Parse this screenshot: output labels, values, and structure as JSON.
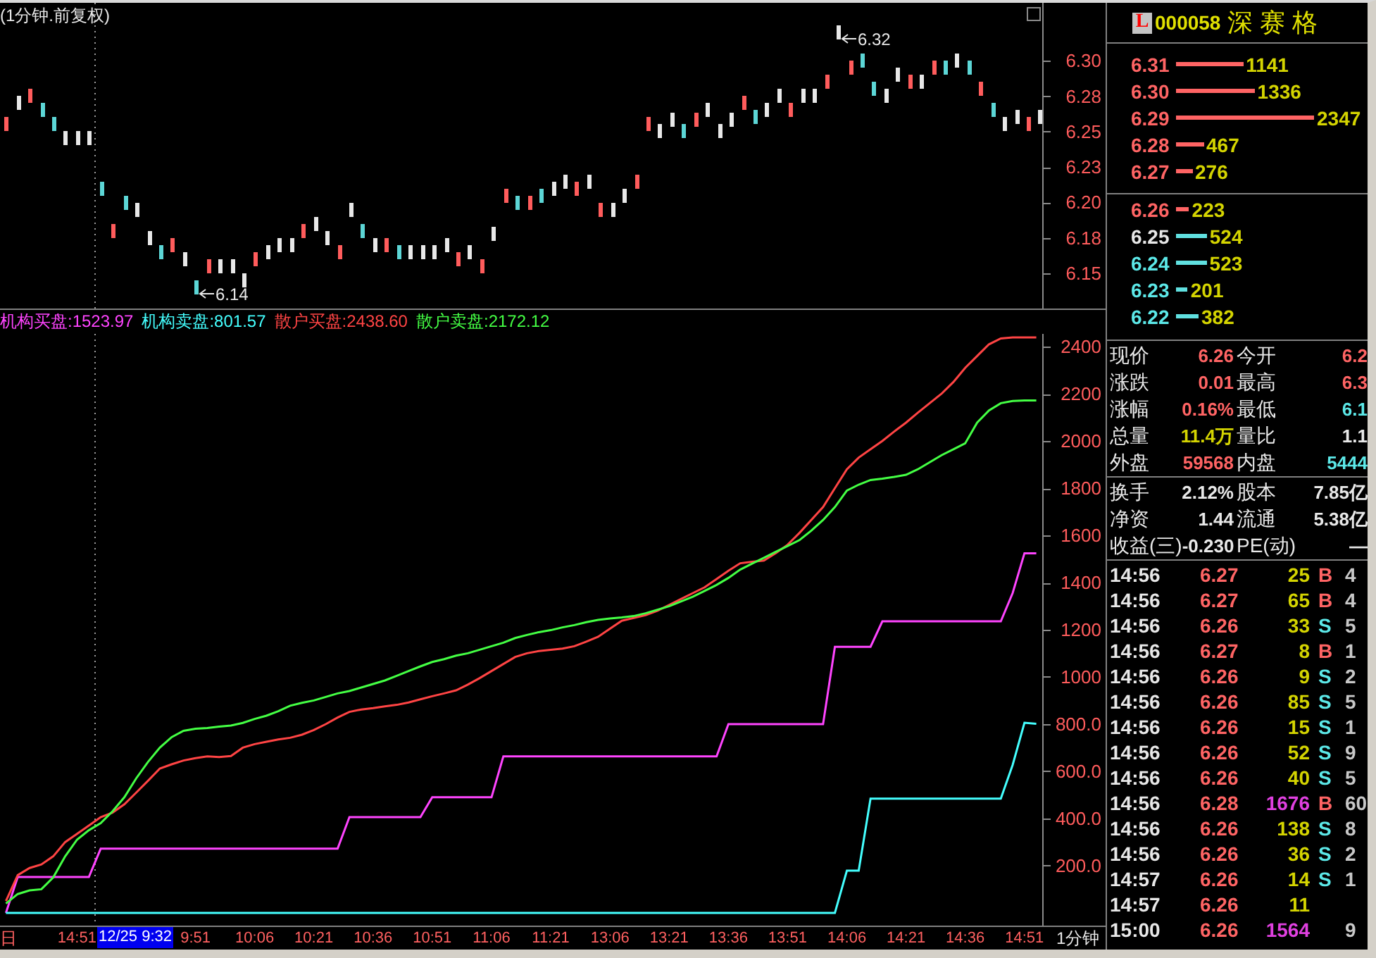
{
  "price_chart": {
    "chart_data": {
      "type": "scatter",
      "title": "(1分钟.前复权)",
      "categories": [
        null,
        null,
        null,
        null,
        null,
        null,
        null,
        null,
        null,
        null,
        null,
        null,
        null,
        null,
        null,
        null,
        null,
        null,
        null,
        null,
        null,
        null,
        null,
        null,
        null,
        null,
        null,
        null,
        null,
        null,
        null,
        null,
        null,
        null,
        null,
        null,
        null,
        null,
        null,
        null,
        null,
        null,
        null,
        null,
        null,
        null,
        null,
        null,
        null,
        null,
        null,
        null,
        null,
        null,
        null,
        null,
        null,
        null,
        null,
        null,
        null,
        null,
        null,
        null,
        null,
        null,
        null,
        null,
        null,
        null,
        null,
        null,
        null,
        null,
        null,
        null,
        null,
        null,
        null,
        null,
        null,
        null,
        null,
        null,
        null,
        null,
        null,
        null,
        null,
        null,
        null,
        null,
        null
      ],
      "ylim": [
        6.125,
        6.341
      ],
      "yticks": [
        {
          "value": 6.15,
          "label": "6.15"
        },
        {
          "value": 6.175,
          "label": "6.18"
        },
        {
          "value": 6.2,
          "label": "6.20"
        },
        {
          "value": 6.225,
          "label": "6.23"
        },
        {
          "value": 6.25,
          "label": "6.25"
        },
        {
          "value": 6.275,
          "label": "6.28"
        },
        {
          "value": 6.3,
          "label": "6.30"
        }
      ],
      "series": [
        {
          "color": "#ff5c5c",
          "values": [
            6.255,
            null,
            6.275,
            null,
            null,
            null,
            null,
            null,
            null,
            6.18,
            null,
            null,
            null,
            null,
            6.17,
            null,
            null,
            6.155,
            null,
            null,
            null,
            6.16,
            null,
            null,
            null,
            6.18,
            null,
            null,
            6.165,
            null,
            null,
            null,
            6.17,
            null,
            null,
            null,
            null,
            null,
            6.16,
            null,
            6.155,
            null,
            6.205,
            null,
            6.2,
            null,
            null,
            null,
            6.21,
            null,
            6.195,
            null,
            null,
            6.215,
            6.255,
            null,
            null,
            null,
            6.258,
            null,
            null,
            null,
            6.27,
            null,
            null,
            null,
            6.265,
            null,
            null,
            6.285,
            null,
            6.295,
            null,
            null,
            null,
            null,
            6.285,
            null,
            6.295,
            null,
            null,
            null,
            6.28,
            null,
            null,
            null,
            6.255,
            null,
            null,
            null,
            null,
            null,
            null
          ]
        },
        {
          "color": "#5cd6d6",
          "values": [
            null,
            null,
            null,
            6.265,
            6.255,
            null,
            null,
            null,
            6.21,
            null,
            6.2,
            null,
            null,
            6.165,
            null,
            null,
            6.14,
            null,
            null,
            null,
            null,
            null,
            null,
            null,
            null,
            null,
            null,
            null,
            null,
            null,
            6.18,
            null,
            null,
            6.165,
            null,
            null,
            null,
            null,
            null,
            null,
            null,
            null,
            null,
            6.2,
            null,
            6.205,
            null,
            null,
            null,
            null,
            null,
            null,
            null,
            null,
            null,
            null,
            null,
            6.25,
            null,
            null,
            null,
            null,
            null,
            6.26,
            null,
            null,
            null,
            null,
            null,
            null,
            null,
            null,
            6.3,
            6.28,
            null,
            null,
            null,
            null,
            null,
            6.295,
            null,
            6.295,
            null,
            6.265,
            null,
            null,
            null,
            null,
            null,
            null,
            null,
            null,
            null
          ]
        },
        {
          "color": "#e8e8e8",
          "values": [
            null,
            6.27,
            null,
            null,
            null,
            6.245,
            6.245,
            6.245,
            null,
            null,
            null,
            6.195,
            6.175,
            null,
            null,
            6.16,
            null,
            null,
            6.155,
            6.155,
            6.145,
            null,
            6.165,
            6.17,
            6.17,
            null,
            6.185,
            6.175,
            null,
            6.195,
            null,
            6.17,
            null,
            null,
            6.165,
            6.165,
            6.165,
            6.17,
            null,
            6.165,
            null,
            6.178,
            null,
            null,
            null,
            null,
            6.21,
            6.215,
            null,
            6.215,
            null,
            6.195,
            6.205,
            null,
            null,
            6.25,
            6.258,
            null,
            null,
            6.265,
            6.25,
            6.258,
            null,
            null,
            6.265,
            6.275,
            null,
            6.275,
            6.275,
            null,
            6.32,
            null,
            null,
            null,
            6.275,
            6.29,
            null,
            6.285,
            null,
            null,
            6.3,
            null,
            null,
            null,
            6.255,
            6.26,
            null,
            6.26,
            null,
            null,
            null,
            null,
            null
          ]
        }
      ],
      "annotations": [
        "6.14",
        "6.32"
      ]
    }
  },
  "flow_chart": {
    "chart_data": {
      "type": "line",
      "categories": [
        null,
        null,
        null,
        null,
        null,
        null,
        "14:51",
        null,
        null,
        null,
        null,
        null,
        null,
        null,
        null,
        null,
        "9:51",
        null,
        null,
        null,
        null,
        "10:06",
        null,
        null,
        null,
        null,
        "10:21",
        null,
        null,
        null,
        null,
        "10:36",
        null,
        null,
        null,
        null,
        "10:51",
        null,
        null,
        null,
        null,
        "11:06",
        null,
        null,
        null,
        null,
        "11:21",
        null,
        null,
        null,
        null,
        "13:06",
        null,
        null,
        null,
        null,
        "13:21",
        null,
        null,
        null,
        null,
        "13:36",
        null,
        null,
        null,
        null,
        "13:51",
        null,
        null,
        null,
        null,
        "14:06",
        null,
        null,
        null,
        null,
        "14:21",
        null,
        null,
        null,
        null,
        "14:36",
        null,
        null,
        null,
        null,
        "14:51",
        null
      ],
      "ylim": [
        -54,
        2454
      ],
      "yticks": [
        {
          "value": 200,
          "label": "200.0"
        },
        {
          "value": 400,
          "label": "400.0"
        },
        {
          "value": 600,
          "label": "600.0"
        },
        {
          "value": 800,
          "label": "800.0"
        },
        1000,
        1200,
        1400,
        1600,
        1800,
        2000,
        2200,
        2400
      ],
      "series": [
        {
          "name": "机构买盘:1523.97",
          "color": "#ff44ff",
          "values": [
            0,
            152,
            152,
            152,
            152,
            152,
            152,
            152,
            272,
            272,
            272,
            272,
            272,
            272,
            272,
            272,
            272,
            272,
            272,
            272,
            272,
            272,
            272,
            272,
            272,
            272,
            272,
            272,
            272,
            406,
            406,
            406,
            406,
            406,
            406,
            406,
            490,
            490,
            490,
            490,
            490,
            490,
            663,
            663,
            663,
            663,
            663,
            663,
            663,
            663,
            663,
            663,
            663,
            663,
            663,
            663,
            663,
            663,
            663,
            663,
            663,
            800,
            800,
            800,
            800,
            800,
            800,
            800,
            800,
            800,
            1128,
            1128,
            1128,
            1128,
            1236,
            1236,
            1236,
            1236,
            1236,
            1236,
            1236,
            1236,
            1236,
            1236,
            1236,
            1355,
            1524,
            1524
          ]
        },
        {
          "name": "机构卖盘:801.57",
          "color": "#44ffff",
          "values": [
            0,
            0,
            0,
            0,
            0,
            0,
            0,
            0,
            0,
            0,
            0,
            0,
            0,
            0,
            0,
            0,
            0,
            0,
            0,
            0,
            0,
            0,
            0,
            0,
            0,
            0,
            0,
            0,
            0,
            0,
            0,
            0,
            0,
            0,
            0,
            0,
            0,
            0,
            0,
            0,
            0,
            0,
            0,
            0,
            0,
            0,
            0,
            0,
            0,
            0,
            0,
            0,
            0,
            0,
            0,
            0,
            0,
            0,
            0,
            0,
            0,
            0,
            0,
            0,
            0,
            0,
            0,
            0,
            0,
            0,
            0,
            179,
            179,
            484,
            484,
            484,
            484,
            484,
            484,
            484,
            484,
            484,
            484,
            484,
            484,
            627,
            806,
            802
          ]
        },
        {
          "name": "散户买盘:2438.60",
          "color": "#ff4444",
          "values": [
            50,
            160,
            190,
            205,
            240,
            300,
            335,
            370,
            406,
            425,
            460,
            510,
            560,
            612,
            630,
            646,
            656,
            663,
            660,
            665,
            700,
            715,
            725,
            735,
            742,
            755,
            775,
            800,
            828,
            852,
            862,
            868,
            875,
            882,
            892,
            905,
            918,
            930,
            943,
            968,
            995,
            1025,
            1055,
            1085,
            1100,
            1110,
            1115,
            1120,
            1130,
            1150,
            1170,
            1205,
            1238,
            1250,
            1262,
            1280,
            1305,
            1330,
            1355,
            1380,
            1415,
            1450,
            1482,
            1488,
            1493,
            1525,
            1560,
            1610,
            1665,
            1720,
            1800,
            1880,
            1930,
            1965,
            2000,
            2040,
            2078,
            2120,
            2160,
            2200,
            2250,
            2310,
            2360,
            2410,
            2435,
            2439,
            2439,
            2439
          ]
        },
        {
          "name": "散户卖盘:2172.12",
          "color": "#44ff44",
          "values": [
            40,
            80,
            95,
            100,
            150,
            240,
            310,
            350,
            380,
            430,
            490,
            570,
            640,
            700,
            745,
            772,
            780,
            784,
            790,
            794,
            805,
            822,
            836,
            855,
            878,
            890,
            900,
            915,
            930,
            940,
            955,
            970,
            985,
            1005,
            1025,
            1045,
            1063,
            1075,
            1090,
            1100,
            1115,
            1130,
            1145,
            1165,
            1178,
            1190,
            1198,
            1210,
            1220,
            1232,
            1242,
            1248,
            1252,
            1258,
            1270,
            1285,
            1300,
            1320,
            1340,
            1365,
            1390,
            1420,
            1455,
            1480,
            1505,
            1530,
            1555,
            1580,
            1620,
            1665,
            1720,
            1790,
            1815,
            1835,
            1840,
            1848,
            1857,
            1880,
            1910,
            1940,
            1965,
            1990,
            2078,
            2130,
            2160,
            2170,
            2172,
            2172
          ]
        }
      ]
    }
  },
  "time_axis": {
    "edge_label": "日",
    "cursor_label": "12/25 9:32",
    "period_label": "1分钟"
  },
  "quote_panel": {
    "badge": "L",
    "code": "000058",
    "name": "深 赛 格",
    "asks": [
      {
        "price": "6.31",
        "volume": "1141",
        "kind": "up"
      },
      {
        "price": "6.30",
        "volume": "1336",
        "kind": "up"
      },
      {
        "price": "6.29",
        "volume": "2347",
        "kind": "up"
      },
      {
        "price": "6.28",
        "volume": "467",
        "kind": "up"
      },
      {
        "price": "6.27",
        "volume": "276",
        "kind": "up"
      }
    ],
    "bids": [
      {
        "price": "6.26",
        "volume": "223",
        "kind": "up"
      },
      {
        "price": "6.25",
        "volume": "524",
        "kind": "flat"
      },
      {
        "price": "6.24",
        "volume": "523",
        "kind": "down"
      },
      {
        "price": "6.23",
        "volume": "201",
        "kind": "down"
      },
      {
        "price": "6.22",
        "volume": "382",
        "kind": "down"
      }
    ],
    "stats": [
      {
        "label": "现价",
        "value": "6.26",
        "kind": "up"
      },
      {
        "label": "今开",
        "value": "6.2",
        "kind": "up"
      },
      {
        "label": "涨跌",
        "value": "0.01",
        "kind": "up"
      },
      {
        "label": "最高",
        "value": "6.3",
        "kind": "up"
      },
      {
        "label": "涨幅",
        "value": "0.16%",
        "kind": "up"
      },
      {
        "label": "最低",
        "value": "6.1",
        "kind": "down"
      },
      {
        "label": "总量",
        "value": "11.4万",
        "kind": "volume"
      },
      {
        "label": "量比",
        "value": "1.1",
        "kind": "flat"
      },
      {
        "label": "外盘",
        "value": "59568",
        "kind": "up"
      },
      {
        "label": "内盘",
        "value": "5444",
        "kind": "down"
      }
    ],
    "fundamentals": [
      {
        "label": "换手",
        "value": "2.12%"
      },
      {
        "label": "股本",
        "value": "7.85亿"
      },
      {
        "label": "净资",
        "value": "1.44"
      },
      {
        "label": "流通",
        "value": "5.38亿"
      },
      {
        "label": "收益(三)",
        "value": "-0.230"
      },
      {
        "label": "PE(动)",
        "value": "—"
      }
    ],
    "trades": [
      {
        "time": "14:56",
        "price": "6.27",
        "volume": "25",
        "large": false,
        "side": "B",
        "buy": true,
        "column_5": "4"
      },
      {
        "time": "14:56",
        "price": "6.27",
        "volume": "65",
        "large": false,
        "side": "B",
        "buy": true,
        "column_5": "4"
      },
      {
        "time": "14:56",
        "price": "6.26",
        "volume": "33",
        "large": false,
        "side": "S",
        "buy": false,
        "column_5": "5"
      },
      {
        "time": "14:56",
        "price": "6.27",
        "volume": "8",
        "large": false,
        "side": "B",
        "buy": true,
        "column_5": "1"
      },
      {
        "time": "14:56",
        "price": "6.26",
        "volume": "9",
        "large": false,
        "side": "S",
        "buy": false,
        "column_5": "2"
      },
      {
        "time": "14:56",
        "price": "6.26",
        "volume": "85",
        "large": false,
        "side": "S",
        "buy": false,
        "column_5": "5"
      },
      {
        "time": "14:56",
        "price": "6.26",
        "volume": "15",
        "large": false,
        "side": "S",
        "buy": false,
        "column_5": "1"
      },
      {
        "time": "14:56",
        "price": "6.26",
        "volume": "52",
        "large": false,
        "side": "S",
        "buy": false,
        "column_5": "9"
      },
      {
        "time": "14:56",
        "price": "6.26",
        "volume": "40",
        "large": false,
        "side": "S",
        "buy": false,
        "column_5": "5"
      },
      {
        "time": "14:56",
        "price": "6.28",
        "volume": "1676",
        "large": true,
        "side": "B",
        "buy": true,
        "column_5": "60"
      },
      {
        "time": "14:56",
        "price": "6.26",
        "volume": "138",
        "large": false,
        "side": "S",
        "buy": false,
        "column_5": "8"
      },
      {
        "time": "14:56",
        "price": "6.26",
        "volume": "36",
        "large": false,
        "side": "S",
        "buy": false,
        "column_5": "2"
      },
      {
        "time": "14:57",
        "price": "6.26",
        "volume": "14",
        "large": false,
        "side": "S",
        "buy": false,
        "column_5": "1"
      },
      {
        "time": "14:57",
        "price": "6.26",
        "volume": "11",
        "large": false
      },
      {
        "time": "15:00",
        "price": "6.26",
        "volume": "1564",
        "large": true,
        "column_5": "9"
      }
    ]
  }
}
